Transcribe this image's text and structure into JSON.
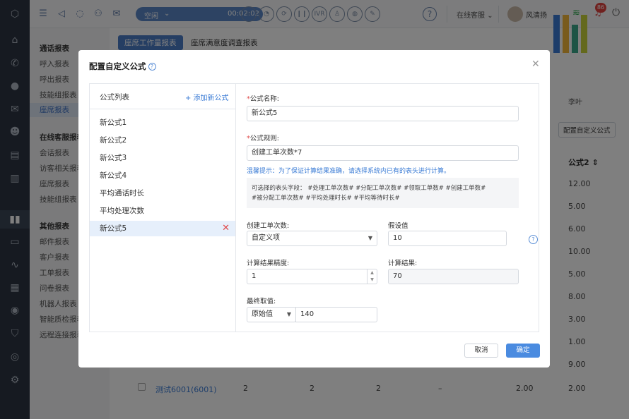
{
  "topbar": {
    "status": "空闲",
    "timer": "00:02:02",
    "ivr_label": "IVR",
    "service_status": "在线客服",
    "username": "风清扬",
    "notification_count": "86"
  },
  "sidebar": {
    "groups": [
      {
        "title": "通话报表",
        "items": [
          "呼入报表",
          "呼出报表",
          "技能组报表",
          "座席报表"
        ]
      },
      {
        "title": "在线客服报表",
        "items": [
          "会话报表",
          "访客相关报表",
          "座席报表",
          "技能组报表"
        ]
      },
      {
        "title": "其他报表",
        "items": [
          "邮件报表",
          "客户报表",
          "工单报表",
          "问卷报表",
          "机器人报表",
          "智能质检报表",
          "远程连接报表"
        ]
      }
    ],
    "active_item": "座席报表"
  },
  "main": {
    "tabs": [
      "座席工作量报表",
      "座席满意度调查报表"
    ],
    "chart_label": "李叶",
    "config_button": "配置自定义公式",
    "column_header": "公式2",
    "column_values": [
      "12.00",
      "5.00",
      "6.00",
      "10.00",
      "5.00",
      "8.00",
      "3.00",
      "1.00",
      "9.00"
    ],
    "bottom_row": {
      "name": "测试6001(6001)",
      "c1": "2",
      "c2": "2",
      "c3": "2",
      "c4": "–",
      "c5": "2.00",
      "c6": "2.00"
    }
  },
  "modal": {
    "title": "配置自定义公式",
    "list_title": "公式列表",
    "add_label": "+ 添加新公式",
    "formulas": [
      "新公式1",
      "新公式2",
      "新公式3",
      "新公式4",
      "平均通话时长",
      "平均处理次数",
      "新公式5"
    ],
    "selected_formula": "新公式5",
    "name_label": "公式名称:",
    "name_value": "新公式5",
    "rule_label": "公式规则:",
    "rule_value": "创建工单次数*7",
    "tip": "温馨提示：为了保证计算结果准确，请选择系统内已有的表头进行计算。",
    "fields_line1": "可选择的表头字段：   #处理工单次数#    #分配工单次数#    #领取工单数#    #创建工单数#",
    "fields_line2": "#被分配工单次数#   #平均处理时长#   #平均等待时长#",
    "var_label": "创建工单次数:",
    "var_select": "自定义项",
    "assume_label": "假设值",
    "assume_value": "10",
    "precision_label": "计算结果精度:",
    "precision_value": "1",
    "result_label": "计算结果:",
    "result_value": "70",
    "final_label": "最终取值:",
    "final_select": "原始值",
    "final_value": "140",
    "cancel": "取消",
    "ok": "确定"
  }
}
